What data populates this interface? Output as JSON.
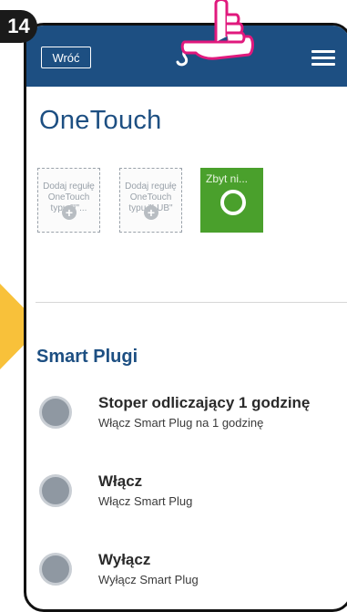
{
  "step_number": "14",
  "header": {
    "back_label": "Wróć",
    "logo": "salus-logo",
    "menu_icon": "hamburger-menu-icon"
  },
  "page_title": "OneTouch",
  "tiles": [
    {
      "label": "Dodaj regułę OneTouch typu \"I\"...",
      "icon": "plus-icon"
    },
    {
      "label": "Dodaj regułę OneTouch typu \"LUB\"",
      "icon": "plus-icon"
    },
    {
      "label": "Zbyt ni...",
      "icon": "ring-icon"
    }
  ],
  "section_title": "Smart Plugi",
  "items": [
    {
      "title": "Stoper odliczający 1 godzinę",
      "subtitle": "Włącz Smart Plug na 1 godzinę"
    },
    {
      "title": "Włącz",
      "subtitle": "Włącz Smart Plug"
    },
    {
      "title": "Wyłącz",
      "subtitle": "Wyłącz Smart Plug"
    }
  ],
  "colors": {
    "header": "#1d4f82",
    "accent_green": "#4aa02c",
    "arrow": "#f8c13a",
    "hand_highlight": "#e0197d"
  }
}
